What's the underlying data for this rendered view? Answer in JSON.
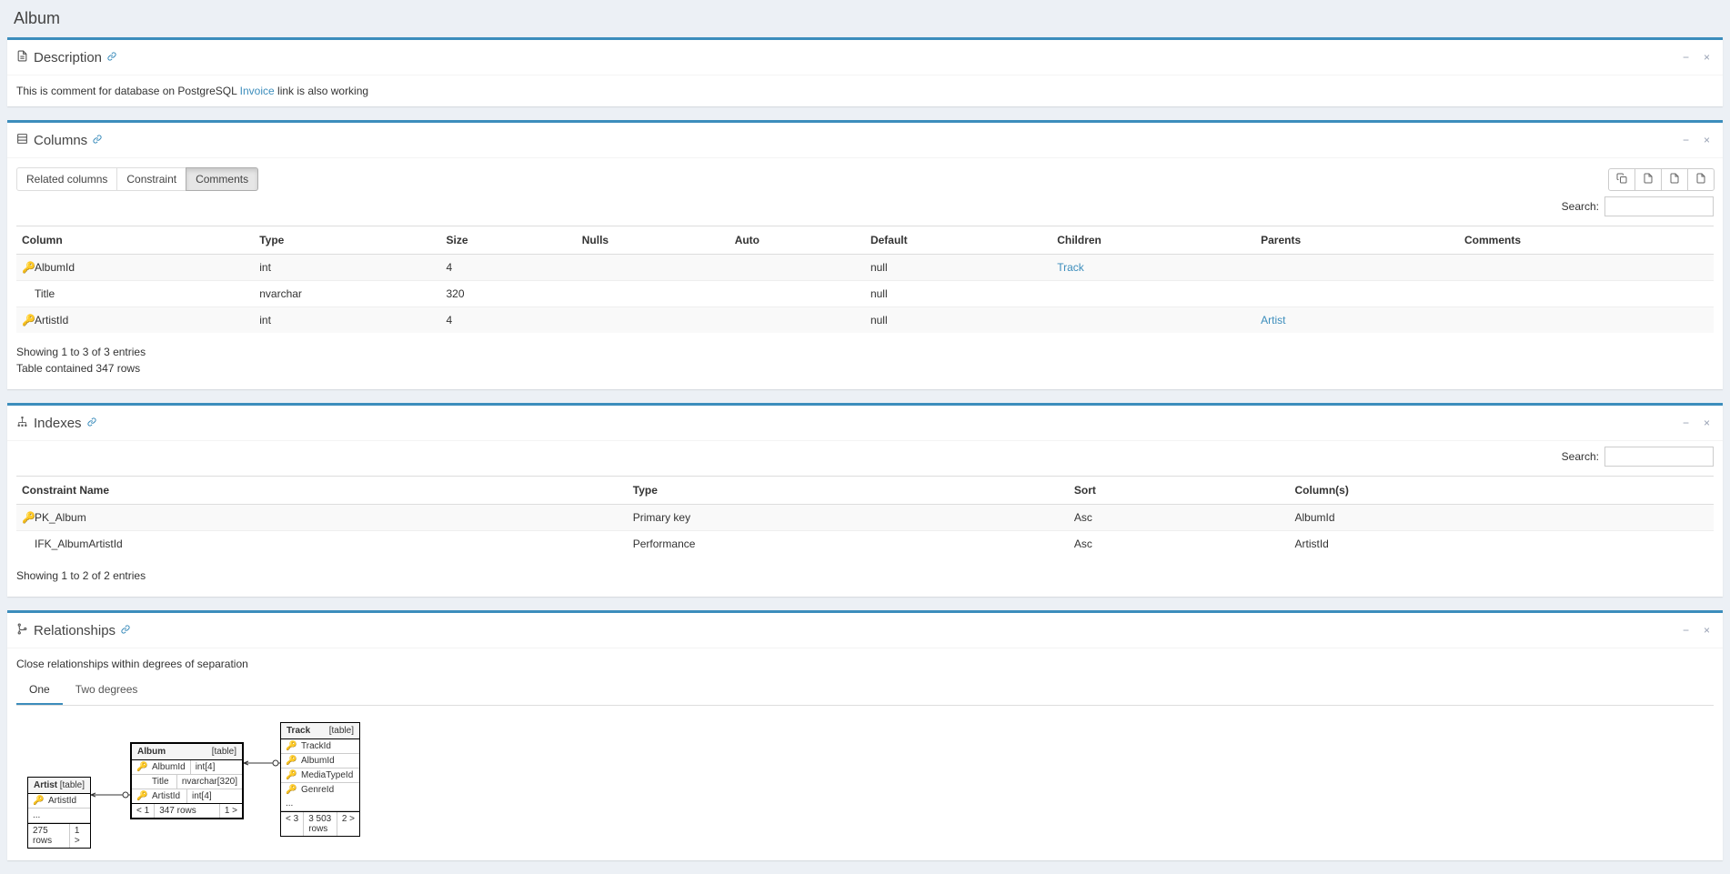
{
  "page": {
    "title": "Album"
  },
  "panels": {
    "description": {
      "title": "Description",
      "text_pre": "This is comment for database on PostgreSQL ",
      "link_text": "Invoice",
      "text_post": " link is also working"
    },
    "columns": {
      "title": "Columns",
      "tabs": {
        "related": "Related columns",
        "constraint": "Constraint",
        "comments": "Comments"
      },
      "search_label": "Search:",
      "headers": {
        "column": "Column",
        "type": "Type",
        "size": "Size",
        "nulls": "Nulls",
        "auto": "Auto",
        "default": "Default",
        "children": "Children",
        "parents": "Parents",
        "comments": "Comments"
      },
      "rows": [
        {
          "key": "pk",
          "name": "AlbumId",
          "type": "int",
          "size": "4",
          "nulls": "",
          "auto": "",
          "default": "null",
          "children": "Track",
          "parents": "",
          "comments": ""
        },
        {
          "key": "none",
          "name": "Title",
          "type": "nvarchar",
          "size": "320",
          "nulls": "",
          "auto": "",
          "default": "null",
          "children": "",
          "parents": "",
          "comments": ""
        },
        {
          "key": "fk",
          "name": "ArtistId",
          "type": "int",
          "size": "4",
          "nulls": "",
          "auto": "",
          "default": "null",
          "children": "",
          "parents": "Artist",
          "comments": ""
        }
      ],
      "footer_line1": "Showing 1 to 3 of 3 entries",
      "footer_line2": "Table contained 347 rows"
    },
    "indexes": {
      "title": "Indexes",
      "search_label": "Search:",
      "headers": {
        "name": "Constraint Name",
        "type": "Type",
        "sort": "Sort",
        "columns": "Column(s)"
      },
      "rows": [
        {
          "key": "pk",
          "name": "PK_Album",
          "type": "Primary key",
          "sort": "Asc",
          "columns": "AlbumId"
        },
        {
          "key": "none",
          "name": "IFK_AlbumArtistId",
          "type": "Performance",
          "sort": "Asc",
          "columns": "ArtistId"
        }
      ],
      "footer": "Showing 1 to 2 of 2 entries"
    },
    "relationships": {
      "title": "Relationships",
      "intro": "Close relationships within degrees of separation",
      "tabs": {
        "one": "One",
        "two": "Two degrees"
      },
      "erd": {
        "table_label": "[table]",
        "artist": {
          "name": "Artist",
          "col": "ArtistId",
          "rows": "275 rows",
          "out": "1 >"
        },
        "album": {
          "name": "Album",
          "cols": [
            {
              "key": "pk",
              "name": "AlbumId",
              "type": "int[4]"
            },
            {
              "key": "none",
              "name": "Title",
              "type": "nvarchar[320]"
            },
            {
              "key": "fk",
              "name": "ArtistId",
              "type": "int[4]"
            }
          ],
          "in": "< 1",
          "rows": "347 rows",
          "out": "1 >"
        },
        "track": {
          "name": "Track",
          "cols": [
            {
              "key": "pk",
              "name": "TrackId"
            },
            {
              "key": "fk",
              "name": "AlbumId"
            },
            {
              "key": "fk",
              "name": "MediaTypeId"
            },
            {
              "key": "fk",
              "name": "GenreId"
            }
          ],
          "ellipsis": "...",
          "in": "< 3",
          "rows": "3 503 rows",
          "out": "2 >"
        }
      }
    }
  }
}
